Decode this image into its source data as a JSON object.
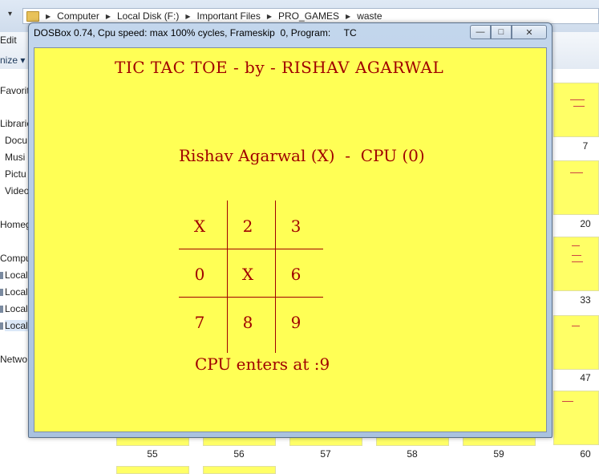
{
  "explorer": {
    "breadcrumb": [
      "Computer",
      "Local Disk (F:)",
      "Important Files",
      "PRO_GAMES",
      "waste"
    ],
    "menu_edit": "Edit",
    "organize": "nize",
    "sidebar": {
      "favorites": "Favorite",
      "libraries": "Librarie",
      "documents": "Docu",
      "music": "Musi",
      "pictures": "Pictu",
      "videos": "Video",
      "homegroup": "Homeg",
      "computer": "Compu",
      "local1": "Local",
      "local2": "Local",
      "local3": "Local",
      "local4": "Local",
      "network": "Netwo"
    },
    "file_numbers": {
      "r1": "7",
      "r2": "20",
      "r3": "33",
      "r4": "47",
      "bottom": [
        "55",
        "56",
        "57",
        "58",
        "59",
        "60"
      ]
    }
  },
  "dosbox": {
    "title": "DOSBox 0.74, Cpu speed: max 100% cycles, Frameskip  0, Program:     TC",
    "minimize_glyph": "—",
    "maximize_glyph": "□",
    "close_glyph": "✕",
    "game": {
      "title": "TIC TAC TOE - by - RISHAV AGARWAL",
      "players": "Rishav Agarwal (X)  -  CPU (0)",
      "board": [
        "X",
        "2",
        "3",
        "0",
        "X",
        "6",
        "7",
        "8",
        "9"
      ],
      "status": "CPU enters at :9"
    }
  }
}
